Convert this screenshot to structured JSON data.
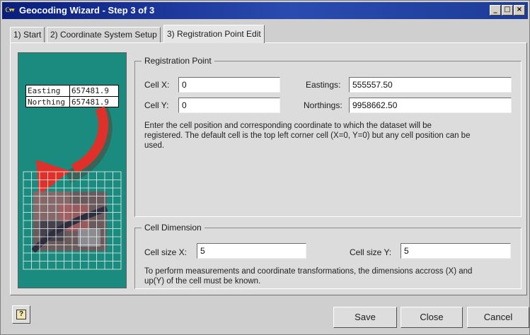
{
  "window": {
    "title": "Geocoding Wizard - Step 3 of 3",
    "controls": {
      "minimize": "_",
      "restore": "□",
      "close": "×"
    }
  },
  "tabs": [
    {
      "label": "1) Start"
    },
    {
      "label": "2) Coordinate System Setup"
    },
    {
      "label": "3) Registration Point Edit"
    }
  ],
  "illustration": {
    "easting_label": "Easting",
    "easting_value": "657481.9",
    "northing_label": "Northing",
    "northing_value": "657481.9"
  },
  "registration_point": {
    "legend": "Registration Point",
    "cell_x_label": "Cell X:",
    "cell_x_value": "0",
    "cell_y_label": "Cell Y:",
    "cell_y_value": "0",
    "eastings_label": "Eastings:",
    "eastings_value": "555557.50",
    "northings_label": "Northings:",
    "northings_value": "9958662.50",
    "description_1": "Enter the  cell position and corresponding coordinate to which the dataset will be",
    "description_2": "registered. The default cell is the top left corner cell (X=0, Y=0) but any cell position can be",
    "description_3": "used."
  },
  "cell_dimension": {
    "legend": "Cell Dimension",
    "size_x_label": "Cell size X:",
    "size_x_value": "5",
    "size_y_label": "Cell size Y:",
    "size_y_value": "5",
    "description_1": "To perform measurements and coordinate transformations, the dimensions accross (X) and",
    "description_2": "up(Y) of the cell must be known."
  },
  "buttons": {
    "help": "?",
    "save": "Save",
    "close": "Close",
    "cancel": "Cancel"
  },
  "colors": {
    "titlebar": "#0a1e7c",
    "illustration_bg": "#1b8a7f",
    "arrow": "#e0302a"
  }
}
